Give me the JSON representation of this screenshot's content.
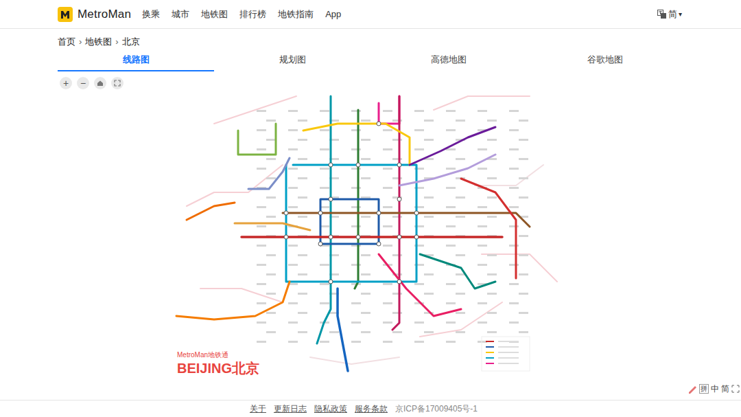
{
  "header": {
    "logo": "MetroMan",
    "nav": [
      {
        "label": "换乘"
      },
      {
        "label": "城市"
      },
      {
        "label": "地铁图"
      },
      {
        "label": "排行榜"
      },
      {
        "label": "地铁指南"
      },
      {
        "label": "App"
      }
    ],
    "language": "简",
    "caret": "▾"
  },
  "breadcrumb": {
    "items": [
      "首页",
      "地铁图",
      "北京"
    ],
    "separator": "›"
  },
  "tabs": [
    {
      "label": "线路图",
      "selected": true
    },
    {
      "label": "规划图",
      "selected": false
    },
    {
      "label": "高德地图",
      "selected": false
    },
    {
      "label": "谷歌地图",
      "selected": false
    }
  ],
  "map_controls": [
    "+",
    "−"
  ],
  "map": {
    "brand": "MetroMan地铁通",
    "city": "BEIJING北京"
  },
  "footer": {
    "links": [
      "关于",
      "更新日志",
      "隐私政策",
      "服务条款"
    ],
    "icp": "京ICP备17009405号-1"
  },
  "ime": [
    "拼",
    "中",
    "简"
  ]
}
